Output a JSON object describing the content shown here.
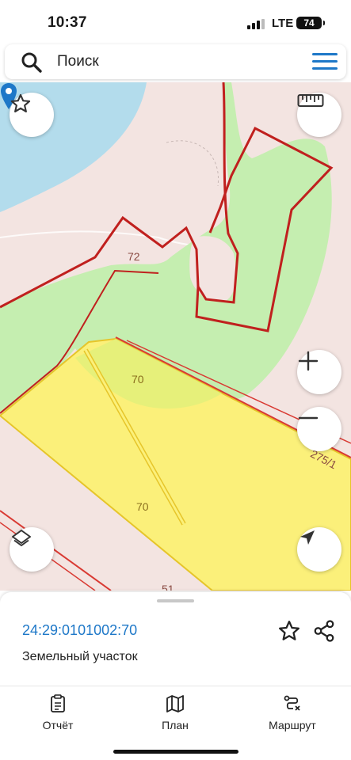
{
  "status_bar": {
    "time": "10:37",
    "network": "LTE",
    "battery": "74"
  },
  "search": {
    "placeholder": "Поиск",
    "icon": "search-icon",
    "menu_icon": "hamburger-menu-icon",
    "accent_color": "#1e78c8"
  },
  "map": {
    "labels": {
      "parcel_72": "72",
      "parcel_70_top": "70",
      "parcel_70_main": "70",
      "parcel_275_1": "275/1",
      "parcel_partial": "51"
    },
    "controls": {
      "favorite": "star-icon",
      "ruler": "ruler-icon",
      "zoom_in": "plus-icon",
      "zoom_out": "minus-icon",
      "layers": "layers-icon",
      "location": "navigation-arrow-icon"
    },
    "colors": {
      "water": "#b3dcec",
      "forest": "#c5eeb0",
      "parcel_fill": "#fbf07a",
      "parcel_border_red": "#c0201e",
      "parcel_border_yellow": "#e6c52a",
      "pin": "#1e78c8"
    }
  },
  "selection": {
    "cadastral_number": "24:29:0101002:70",
    "type": "Земельный участок"
  },
  "tabs": [
    {
      "label": "Отчёт",
      "icon": "report-icon"
    },
    {
      "label": "План",
      "icon": "map-plan-icon"
    },
    {
      "label": "Маршрут",
      "icon": "route-icon"
    }
  ]
}
